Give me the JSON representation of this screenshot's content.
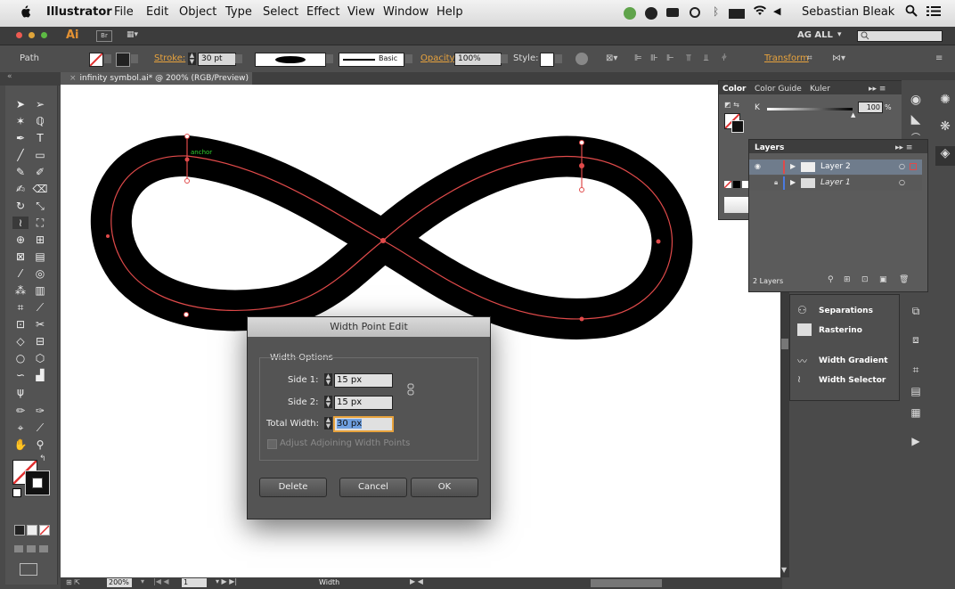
{
  "menubar": {
    "apple": "",
    "app": "Illustrator",
    "items": [
      "File",
      "Edit",
      "Object",
      "Type",
      "Select",
      "Effect",
      "View",
      "Window",
      "Help"
    ],
    "user": "Sebastian Bleak"
  },
  "appbar": {
    "logo": "Ai",
    "br": "Br",
    "workspace": "AG ALL",
    "workspace_arrow": "▾"
  },
  "control": {
    "selection": "Path",
    "stroke_label": "Stroke:",
    "stroke_value": "30 pt",
    "profile": "Basic",
    "opacity_label": "Opacity:",
    "opacity_value": "100%",
    "style_label": "Style:",
    "transform": "Transform"
  },
  "document": {
    "tab": "infinity symbol.ai* @ 200% (RGB/Preview)",
    "anchor_label": "anchor"
  },
  "status": {
    "zoom": "200%",
    "page": "1",
    "tool": "Width"
  },
  "color_panel": {
    "tabs": [
      "Color",
      "Color Guide",
      "Kuler"
    ],
    "channel": "K",
    "value": "100",
    "unit": "%"
  },
  "layers_panel": {
    "title": "Layers",
    "layers": [
      {
        "name": "Layer 2",
        "color": "#e04a4a"
      },
      {
        "name": "Layer 1",
        "color": "#4a7ae0"
      }
    ],
    "count": "2 Layers"
  },
  "side_panels": {
    "items": [
      "Separations",
      "Rasterino",
      "Width Gradient",
      "Width Selector"
    ]
  },
  "dialog": {
    "title": "Width Point Edit",
    "group": "Width Options",
    "side1_label": "Side 1:",
    "side1_value": "15 px",
    "side2_label": "Side 2:",
    "side2_value": "15 px",
    "total_label": "Total Width:",
    "total_value": "30 px",
    "adjust_label": "Adjust Adjoining Width Points",
    "delete": "Delete",
    "cancel": "Cancel",
    "ok": "OK"
  }
}
